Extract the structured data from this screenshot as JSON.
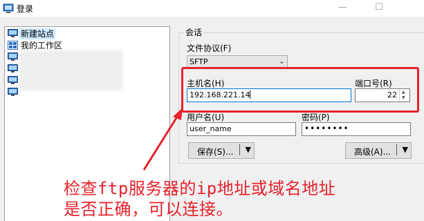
{
  "window": {
    "title": "登录",
    "minimize_glyph": "—",
    "maximize_glyph": "☐"
  },
  "tree": {
    "items": [
      {
        "label": "新建站点",
        "icon": "monitor-icon",
        "selected": true
      },
      {
        "label": "我的工作区",
        "icon": "workspace-icon",
        "selected": false
      },
      {
        "label": "",
        "icon": "monitor-icon",
        "selected": false
      },
      {
        "label": "",
        "icon": "monitor-icon",
        "selected": false
      },
      {
        "label": "",
        "icon": "monitor-icon",
        "selected": false
      },
      {
        "label": "",
        "icon": "monitor-icon",
        "selected": false
      }
    ]
  },
  "session": {
    "group_title": "会话",
    "protocol_label": "文件协议(F)",
    "protocol_value": "SFTP",
    "host_label": "主机名(H)",
    "host_value": "192.168.221.14",
    "port_label": "端口号(R)",
    "port_value": "22",
    "user_label": "用户名(U)",
    "user_value": "user_name",
    "password_label": "密码(P)",
    "password_value": "••••••••",
    "save_button": "保存(S)...",
    "advanced_button": "高级(A)..."
  },
  "annotation": {
    "line1": "检查ftp服务器的ip地址或域名地址",
    "line2": "是否正确，可以连接。",
    "color": "#e8222c"
  }
}
